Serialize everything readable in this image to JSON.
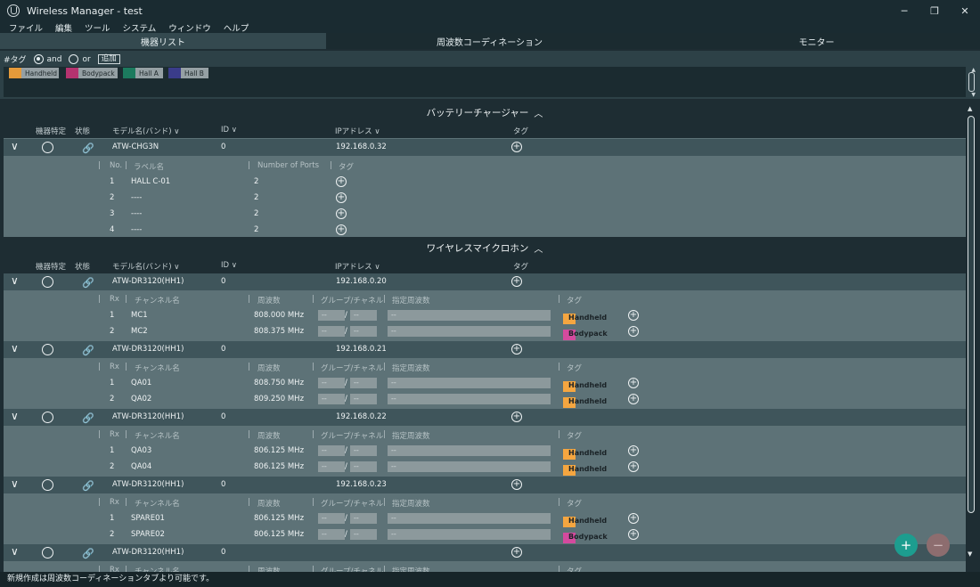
{
  "window": {
    "title": "Wireless Manager - test",
    "controls": [
      "─",
      "❐",
      "✕"
    ]
  },
  "menu": [
    "ファイル",
    "編集",
    "ツール",
    "システム",
    "ウィンドウ",
    "ヘルプ"
  ],
  "tabs": [
    "機器リスト",
    "周波数コーディネーション",
    "モニター"
  ],
  "tagbar": {
    "label": "#タグ",
    "and": "and",
    "or": "or",
    "add": "追加",
    "tags": [
      {
        "name": "Handheld",
        "color": "#e49a3a"
      },
      {
        "name": "Bodypack",
        "color": "#b5336f"
      },
      {
        "name": "Hall A",
        "color": "#1c7a5e"
      },
      {
        "name": "Hall B",
        "color": "#3a3c8a"
      }
    ]
  },
  "col": {
    "ident": "機器特定",
    "status": "状態",
    "model": "モデル名(バンド) ∨",
    "id": "ID ∨",
    "ip": "IPアドレス ∨",
    "tag": "タグ"
  },
  "charger": {
    "title": "バッテリーチャージャー",
    "device": {
      "model": "ATW-CHG3N",
      "id": "0",
      "ip": "192.168.0.32"
    },
    "sub": {
      "no": "No.",
      "label": "ラベル名",
      "ports": "Number of Ports",
      "tag": "タグ"
    },
    "rows": [
      {
        "no": "1",
        "label": "HALL C-01",
        "ports": "2"
      },
      {
        "no": "2",
        "label": "----",
        "ports": "2"
      },
      {
        "no": "3",
        "label": "----",
        "ports": "2"
      },
      {
        "no": "4",
        "label": "----",
        "ports": "2"
      }
    ]
  },
  "mic": {
    "title": "ワイヤレスマイクロホン",
    "sub": {
      "rx": "Rx",
      "ch": "チャンネル名",
      "freq": "周波数",
      "grp": "グループ/チャネル",
      "spec": "指定周波数",
      "tag": "タグ"
    },
    "devices": [
      {
        "model": "ATW-DR3120(HH1)",
        "id": "0",
        "ip": "192.168.0.20",
        "rows": [
          {
            "rx": "1",
            "ch": "MC1",
            "freq": "808.000 MHz",
            "tag": "Handheld",
            "tagcolor": "#f5a640"
          },
          {
            "rx": "2",
            "ch": "MC2",
            "freq": "808.375 MHz",
            "tag": "Bodypack",
            "tagcolor": "#d44a9e"
          }
        ]
      },
      {
        "model": "ATW-DR3120(HH1)",
        "id": "0",
        "ip": "192.168.0.21",
        "rows": [
          {
            "rx": "1",
            "ch": "QA01",
            "freq": "808.750 MHz",
            "tag": "Handheld",
            "tagcolor": "#f5a640"
          },
          {
            "rx": "2",
            "ch": "QA02",
            "freq": "809.250 MHz",
            "tag": "Handheld",
            "tagcolor": "#f5a640"
          }
        ]
      },
      {
        "model": "ATW-DR3120(HH1)",
        "id": "0",
        "ip": "192.168.0.22",
        "rows": [
          {
            "rx": "1",
            "ch": "QA03",
            "freq": "806.125 MHz",
            "tag": "Handheld",
            "tagcolor": "#f5a640"
          },
          {
            "rx": "2",
            "ch": "QA04",
            "freq": "806.125 MHz",
            "tag": "Handheld",
            "tagcolor": "#f5a640"
          }
        ]
      },
      {
        "model": "ATW-DR3120(HH1)",
        "id": "0",
        "ip": "192.168.0.23",
        "rows": [
          {
            "rx": "1",
            "ch": "SPARE01",
            "freq": "806.125 MHz",
            "tag": "Handheld",
            "tagcolor": "#f5a640"
          },
          {
            "rx": "2",
            "ch": "SPARE02",
            "freq": "806.125 MHz",
            "tag": "Bodypack",
            "tagcolor": "#d44a9e"
          }
        ]
      },
      {
        "model": "ATW-DR3120(HH1)",
        "id": "0",
        "ip": "",
        "rows": []
      }
    ],
    "dash": "--",
    "slash": "/"
  },
  "status": "新規作成は周波数コーディネーションタブより可能です。"
}
